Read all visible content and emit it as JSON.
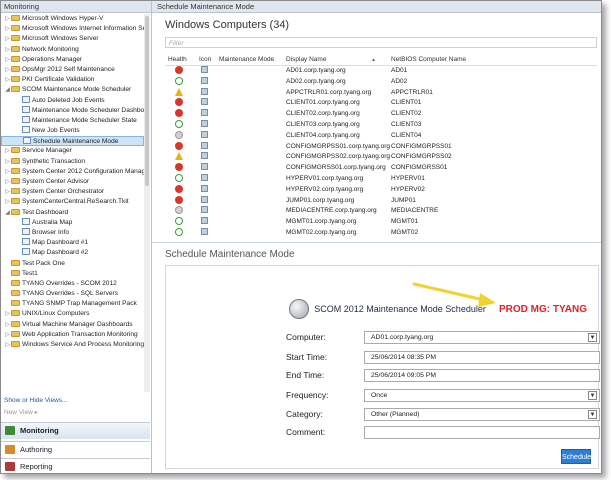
{
  "nav": {
    "header": "Monitoring",
    "items": [
      {
        "label": "Microsoft Windows Hyper-V",
        "kind": "folder",
        "exp": "+"
      },
      {
        "label": "Microsoft Windows Internet Information Servic",
        "kind": "folder",
        "exp": "+"
      },
      {
        "label": "Microsoft Windows Server",
        "kind": "folder",
        "exp": "+"
      },
      {
        "label": "Network Monitoring",
        "kind": "folder",
        "exp": "+"
      },
      {
        "label": "Operations Manager",
        "kind": "folder",
        "exp": "+"
      },
      {
        "label": "OpsMgr 2012 Self Maintenance",
        "kind": "folder",
        "exp": "+"
      },
      {
        "label": "PKI Certificate Validation",
        "kind": "folder",
        "exp": "+"
      },
      {
        "label": "SCOM Maintenance Mode Scheduler",
        "kind": "folder",
        "exp": "-"
      },
      {
        "label": "Auto Deleted Job Events",
        "kind": "view",
        "indent": 1
      },
      {
        "label": "Maintenance Mode Scheduler Dashboard",
        "kind": "view",
        "indent": 1
      },
      {
        "label": "Maintenance Mode Scheduler State",
        "kind": "view",
        "indent": 1
      },
      {
        "label": "New Job Events",
        "kind": "view",
        "indent": 1
      },
      {
        "label": "Schedule Maintenance Mode",
        "kind": "view",
        "indent": 1,
        "selected": true
      },
      {
        "label": "Service Manager",
        "kind": "folder",
        "exp": "+"
      },
      {
        "label": "Synthetic Transaction",
        "kind": "folder",
        "exp": "+"
      },
      {
        "label": "System Center 2012 Configuration Manager",
        "kind": "folder",
        "exp": "+"
      },
      {
        "label": "System Center Advisor",
        "kind": "folder",
        "exp": "+"
      },
      {
        "label": "System Center Orchestrator",
        "kind": "folder",
        "exp": "+"
      },
      {
        "label": "SystemCenterCentral.ReSearch.Tkit",
        "kind": "folder",
        "exp": "+"
      },
      {
        "label": "Test Dashboard",
        "kind": "folder",
        "exp": "-"
      },
      {
        "label": "Australia Map",
        "kind": "view",
        "indent": 1
      },
      {
        "label": "Browser Info",
        "kind": "view",
        "indent": 1
      },
      {
        "label": "Map Dashboard #1",
        "kind": "view",
        "indent": 1
      },
      {
        "label": "Map Dashboard #2",
        "kind": "view",
        "indent": 1
      },
      {
        "label": "Test Pack One",
        "kind": "folder",
        "exp": ""
      },
      {
        "label": "Test1",
        "kind": "folder",
        "exp": ""
      },
      {
        "label": "TYANG Overrides - SCOM 2012",
        "kind": "folder",
        "exp": ""
      },
      {
        "label": "TYANG Overrides - SQL Servers",
        "kind": "folder",
        "exp": ""
      },
      {
        "label": "TYANG SNMP Trap Management Pack",
        "kind": "folder",
        "exp": ""
      },
      {
        "label": "UNIX/Linux Computers",
        "kind": "folder",
        "exp": "+"
      },
      {
        "label": "Virtual Machine Manager Dashboards",
        "kind": "folder",
        "exp": "+"
      },
      {
        "label": "Web Application Transaction Monitoring",
        "kind": "folder",
        "exp": "+"
      },
      {
        "label": "Windows Service And Process Monitoring",
        "kind": "folder",
        "exp": "+"
      }
    ],
    "links": {
      "show_hide": "Show or Hide Views...",
      "new_view": "New View ▸"
    },
    "wunderbar": [
      {
        "label": "Monitoring",
        "color": "#3f8a3a"
      },
      {
        "label": "Authoring",
        "color": "#d88a2c"
      },
      {
        "label": "Reporting",
        "color": "#b03a3a"
      }
    ]
  },
  "main": {
    "header": "Schedule Maintenance Mode",
    "grid_title": "Windows Computers (34)",
    "filter_placeholder": "Filter",
    "columns": {
      "health": "Health",
      "icon": "Icon",
      "mm": "Maintenance Mode",
      "display": "Display Name",
      "netbios": "NetBIOS Computer Name",
      "sort": "▲"
    },
    "rows": [
      {
        "health": "crit",
        "display": "AD01.corp.tyang.org",
        "netbios": "AD01"
      },
      {
        "health": "ok",
        "display": "AD02.corp.tyang.org",
        "netbios": "AD02"
      },
      {
        "health": "warn",
        "display": "APPCTRLR01.corp.tyang.org",
        "netbios": "APPCTRLR01"
      },
      {
        "health": "crit",
        "display": "CLIENT01.corp.tyang.org",
        "netbios": "CLIENT01"
      },
      {
        "health": "crit",
        "display": "CLIENT02.corp.tyang.org",
        "netbios": "CLIENT02"
      },
      {
        "health": "ok",
        "display": "CLIENT03.corp.tyang.org",
        "netbios": "CLIENT03"
      },
      {
        "health": "unk",
        "display": "CLIENT04.corp.tyang.org",
        "netbios": "CLIENT04"
      },
      {
        "health": "crit",
        "display": "CONFIGMGRPSS01.corp.tyang.org",
        "netbios": "CONFIGMGRPSS01"
      },
      {
        "health": "warn",
        "display": "CONFIGMGRPSS02.corp.tyang.org",
        "netbios": "CONFIGMGRPSS02"
      },
      {
        "health": "crit",
        "display": "CONFIGMGRSS01.corp.tyang.org",
        "netbios": "CONFIGMGRSS01"
      },
      {
        "health": "ok",
        "display": "HYPERV01.corp.tyang.org",
        "netbios": "HYPERV01"
      },
      {
        "health": "crit",
        "display": "HYPERV02.corp.tyang.org",
        "netbios": "HYPERV02"
      },
      {
        "health": "crit",
        "display": "JUMP01.corp.tyang.org",
        "netbios": "JUMP01"
      },
      {
        "health": "unk",
        "display": "MEDIACENTRE.corp.tyang.org",
        "netbios": "MEDIACENTRE"
      },
      {
        "health": "ok",
        "display": "MGMT01.corp.tyang.org",
        "netbios": "MGMT01"
      },
      {
        "health": "ok",
        "display": "MGMT02.corp.tyang.org",
        "netbios": "MGMT02"
      },
      {
        "health": "ok",
        "display": "OPSMGRDB01.corp.tyang.org",
        "netbios": "OPSMGRDB01"
      }
    ]
  },
  "schedule": {
    "title": "Schedule Maintenance Mode",
    "logo_text": "SCOM 2012 Maintenance Mode Scheduler",
    "prod_label": "PROD MG: TYANG",
    "fields": {
      "computer": {
        "label": "Computer:",
        "value": "AD01.corp.tyang.org"
      },
      "start": {
        "label": "Start Time:",
        "value": "25/06/2014 08:35 PM"
      },
      "end": {
        "label": "End Time:",
        "value": "25/06/2014 09:05 PM"
      },
      "frequency": {
        "label": "Frequency:",
        "value": "Once"
      },
      "category": {
        "label": "Category:",
        "value": "Other (Planned)"
      },
      "comment": {
        "label": "Comment:",
        "value": ""
      }
    },
    "button": "Schedule"
  }
}
